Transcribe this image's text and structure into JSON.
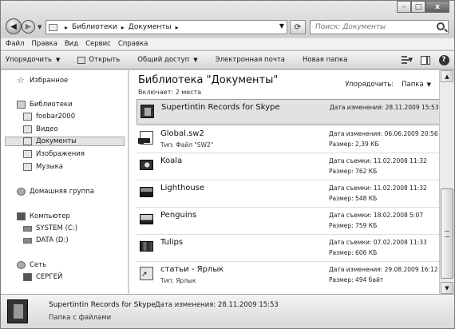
{
  "window": {
    "address": {
      "crumbs": [
        "Библиотеки",
        "Документы"
      ]
    },
    "search": {
      "placeholder": "Поиск: Документы"
    },
    "controls": {
      "minimize": "–",
      "maximize": "□",
      "close": "x"
    }
  },
  "menubar": {
    "items": [
      "Файл",
      "Правка",
      "Вид",
      "Сервис",
      "Справка"
    ]
  },
  "toolbar": {
    "organize": "Упорядочить",
    "open": "Открыть",
    "share": "Общий доступ",
    "email": "Электронная почта",
    "new_folder": "Новая папка"
  },
  "sidebar": {
    "items": [
      {
        "label": "Избранное",
        "icon": "star-icon"
      },
      {
        "label": "Библиотеки",
        "icon": "library-icon"
      },
      {
        "label": "foobar2000",
        "icon": "folder-icon"
      },
      {
        "label": "Видео",
        "icon": "video-library-icon"
      },
      {
        "label": "Документы",
        "icon": "documents-library-icon",
        "selected": true
      },
      {
        "label": "Изображения",
        "icon": "pictures-library-icon"
      },
      {
        "label": "Музыка",
        "icon": "music-library-icon"
      },
      {
        "label": "Домашняя группа",
        "icon": "homegroup-icon"
      },
      {
        "label": "Компьютер",
        "icon": "computer-icon"
      },
      {
        "label": "SYSTEM (C:)",
        "icon": "drive-icon"
      },
      {
        "label": "DATA (D:)",
        "icon": "drive-icon"
      },
      {
        "label": "Сеть",
        "icon": "network-icon"
      },
      {
        "label": "СЕРГЕЙ",
        "icon": "network-computer-icon"
      }
    ]
  },
  "content": {
    "title": "Библиотека \"Документы\"",
    "subtitle": "Включает: 2 места",
    "arrange_label": "Упорядочить:",
    "arrange_value": "Папка"
  },
  "files": [
    {
      "name": "Supertintin Records for Skype",
      "type": "",
      "meta1": "Дата изменения: 28.11.2009 15:53",
      "meta2": "",
      "selected": true,
      "icon": "folder-icon"
    },
    {
      "name": "Global.sw2",
      "type": "Тип: Файл \"SW2\"",
      "meta1": "Дата изменения: 06.06.2009 20:56",
      "meta2": "Размер: 2,39 КБ",
      "icon": "file-icon"
    },
    {
      "name": "Koala",
      "type": "",
      "meta1": "Дата съемки: 11.02.2008 11:32",
      "meta2": "Размер: 762 КБ",
      "icon": "image-thumbnail-icon"
    },
    {
      "name": "Lighthouse",
      "type": "",
      "meta1": "Дата съемки: 11.02.2008 11:32",
      "meta2": "Размер: 548 КБ",
      "icon": "image-thumbnail-icon"
    },
    {
      "name": "Penguins",
      "type": "",
      "meta1": "Дата съемки: 18.02.2008 5:07",
      "meta2": "Размер: 759 КБ",
      "icon": "image-thumbnail-icon"
    },
    {
      "name": "Tulips",
      "type": "",
      "meta1": "Дата съемки: 07.02.2008 11:33",
      "meta2": "Размер: 606 КБ",
      "icon": "image-thumbnail-icon"
    },
    {
      "name": "статьи - Ярлык",
      "type": "Тип: Ярлык",
      "meta1": "Дата изменения: 29.08.2009 16:12",
      "meta2": "Размер: 494 байт",
      "icon": "shortcut-icon"
    }
  ],
  "details": {
    "name": "Supertintin Records for Skype",
    "date": "Дата изменения: 28.11.2009 15:53",
    "type": "Папка с файлами"
  }
}
